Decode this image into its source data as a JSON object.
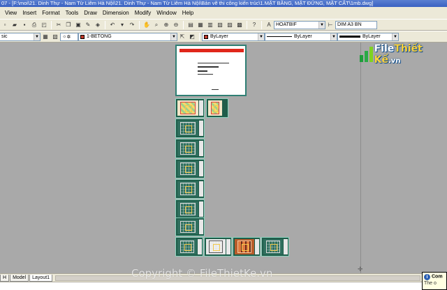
{
  "window": {
    "title": "07 - [F:\\moi\\21. Dinh Thự - Nam Từ Liêm Hà Nội\\21. Dinh Thự - Nam Từ Liêm Hà Nội\\Bản vẽ thi công kiến trúc\\1.MẶT BẰNG, MẶT ĐỨNG, MẶT CẮT\\1mb.dwg]"
  },
  "menu": [
    "View",
    "Insert",
    "Format",
    "Tools",
    "Draw",
    "Dimension",
    "Modify",
    "Window",
    "Help"
  ],
  "toolbar": {
    "text_style": "HOATBIF",
    "dim_style": "DIM A3 BN",
    "layer_state_partial": "sic",
    "current_layer": "1-BETONG",
    "color_control": "ByLayer",
    "linetype_control": "ByLayer",
    "lineweight_control": "ByLayer",
    "colors": {
      "layer_swatch": "#c0392b",
      "color_swatch": "#c0392b"
    }
  },
  "layout_tabs": [
    "H",
    "Model",
    "Layout1"
  ],
  "active_tab": "Layout1",
  "notification": {
    "title": "Com",
    "text": "The o"
  },
  "watermark": {
    "logo_prefix": "File",
    "logo_name": "Thiết Kế",
    "logo_tld": ".vn",
    "copyright": "Copyright © FileThietKe.vn"
  }
}
